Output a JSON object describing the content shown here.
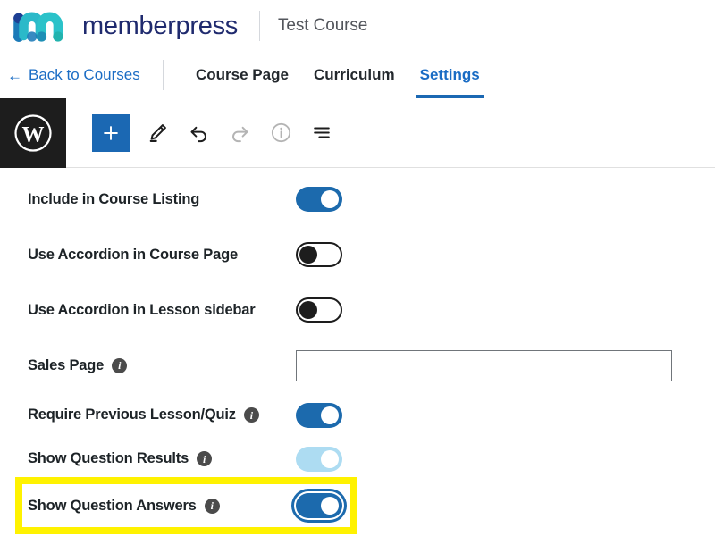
{
  "header": {
    "brand_name": "memberpress",
    "course_title": "Test Course",
    "logo_icon": "memberpress-m-logo",
    "brand_color": "#1f2a6e",
    "logo_colors": [
      "#1d3f94",
      "#2b9fc4",
      "#2bc4c4",
      "#1b7ab8"
    ]
  },
  "nav": {
    "back_label": "Back to Courses",
    "back_arrow": "←",
    "tabs": [
      {
        "label": "Course Page",
        "active": false
      },
      {
        "label": "Curriculum",
        "active": false
      },
      {
        "label": "Settings",
        "active": true
      }
    ],
    "accent_color": "#1a6cc4"
  },
  "toolbar": {
    "wp_logo_icon": "wordpress-logo-icon",
    "add_block_label": "+",
    "add_block_icon": "plus-icon",
    "add_block_color": "#1b68b3",
    "items": [
      {
        "icon": "pencil-edit-icon",
        "label": "Edit",
        "disabled": false
      },
      {
        "icon": "undo-arrow-icon",
        "label": "Undo",
        "disabled": false
      },
      {
        "icon": "redo-arrow-icon",
        "label": "Redo",
        "disabled": true
      },
      {
        "icon": "info-circle-icon",
        "label": "Details",
        "disabled": true
      },
      {
        "icon": "list-view-icon",
        "label": "List view",
        "disabled": false
      }
    ]
  },
  "settings": {
    "rows": [
      {
        "label": "Include in Course Listing",
        "control": "toggle",
        "state": "on",
        "has_info": false,
        "highlighted": false
      },
      {
        "label": "Use Accordion in Course Page",
        "control": "toggle",
        "state": "off",
        "has_info": false,
        "highlighted": false
      },
      {
        "label": "Use Accordion in Lesson sidebar",
        "control": "toggle",
        "state": "off",
        "has_info": false,
        "highlighted": false
      },
      {
        "label": "Sales Page",
        "control": "text",
        "value": "",
        "placeholder": "",
        "has_info": true,
        "highlighted": false
      },
      {
        "label": "Require Previous Lesson/Quiz",
        "control": "toggle",
        "state": "on",
        "has_info": true,
        "highlighted": false
      },
      {
        "label": "Show Question Results",
        "control": "toggle",
        "state": "faded",
        "has_info": true,
        "highlighted": false
      },
      {
        "label": "Show Question Answers",
        "control": "toggle",
        "state": "on",
        "focused": true,
        "has_info": true,
        "highlighted": true
      }
    ],
    "info_glyph": "i",
    "toggle_on_color": "#1c6aad",
    "toggle_faded_color": "#addcf2",
    "highlight_color": "#fff200"
  }
}
